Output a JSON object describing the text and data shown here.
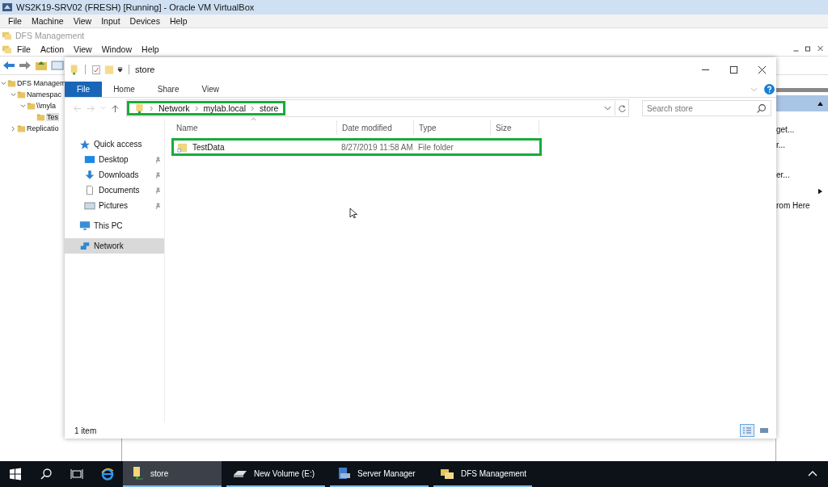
{
  "host_window": {
    "title": "WS2K19-SRV02 (FRESH) [Running] - Oracle VM VirtualBox",
    "menu": [
      "File",
      "Machine",
      "View",
      "Input",
      "Devices",
      "Help"
    ]
  },
  "mmc": {
    "title": "DFS Management",
    "menu": [
      "File",
      "Action",
      "View",
      "Window",
      "Help"
    ],
    "tree": [
      {
        "label": "DFS Managem",
        "expanded": true,
        "selected": false,
        "children": [
          {
            "label": "Namespac",
            "expanded": true,
            "selected": false,
            "children": [
              {
                "label": "\\\\myla",
                "expanded": true,
                "selected": false,
                "children": [
                  {
                    "label": "Tes",
                    "selected": true
                  }
                ]
              }
            ]
          },
          {
            "label": "Replicatio",
            "expanded": false,
            "selected": false
          }
        ]
      }
    ],
    "actions": [
      "get...",
      "r...",
      "er...",
      "rom Here"
    ]
  },
  "explorer": {
    "title": "store",
    "ribbon_tabs": [
      {
        "label": "File",
        "selected": true
      },
      {
        "label": "Home",
        "selected": false
      },
      {
        "label": "Share",
        "selected": false
      },
      {
        "label": "View",
        "selected": false
      }
    ],
    "address": {
      "crumbs": [
        "Network",
        "mylab.local",
        "store"
      ],
      "highlighted": true
    },
    "search": {
      "placeholder": "Search store"
    },
    "nav": [
      {
        "label": "Quick access",
        "kind": "group",
        "pinned": false,
        "selected": false
      },
      {
        "label": "Desktop",
        "kind": "item",
        "pinned": true,
        "selected": false
      },
      {
        "label": "Downloads",
        "kind": "item",
        "pinned": true,
        "selected": false
      },
      {
        "label": "Documents",
        "kind": "item",
        "pinned": true,
        "selected": false
      },
      {
        "label": "Pictures",
        "kind": "item",
        "pinned": true,
        "selected": false
      },
      {
        "label": "This PC",
        "kind": "group",
        "pinned": false,
        "selected": false
      },
      {
        "label": "Network",
        "kind": "group",
        "pinned": false,
        "selected": true
      }
    ],
    "columns": [
      "Name",
      "Date modified",
      "Type",
      "Size"
    ],
    "rows": [
      {
        "name": "TestData",
        "date": "8/27/2019 11:58 AM",
        "type": "File folder",
        "highlighted": true
      }
    ],
    "status": "1 item",
    "views": [
      {
        "kind": "details",
        "selected": true
      },
      {
        "kind": "large",
        "selected": false
      }
    ]
  },
  "taskbar": [
    {
      "label": "store",
      "selected": true
    },
    {
      "label": "New Volume (E:)",
      "selected": false
    },
    {
      "label": "Server Manager",
      "selected": false
    },
    {
      "label": "DFS Management",
      "selected": false
    }
  ]
}
